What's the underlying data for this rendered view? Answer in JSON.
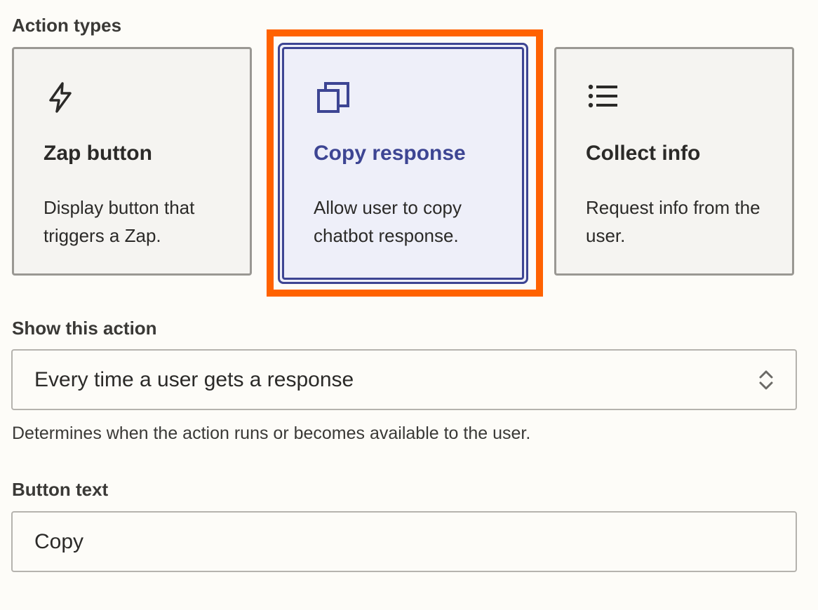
{
  "action_types": {
    "label": "Action types",
    "cards": [
      {
        "title": "Zap button",
        "description": "Display button that triggers a Zap.",
        "icon": "lightning-icon",
        "selected": false
      },
      {
        "title": "Copy response",
        "description": "Allow user to copy chatbot response.",
        "icon": "copy-icon",
        "selected": true
      },
      {
        "title": "Collect info",
        "description": "Request info from the user.",
        "icon": "list-icon",
        "selected": false
      }
    ]
  },
  "show_action": {
    "label": "Show this action",
    "selected": "Every time a user gets a response",
    "helper": "Determines when the action runs or becomes available to the user."
  },
  "button_text": {
    "label": "Button text",
    "value": "Copy"
  },
  "colors": {
    "accent": "#3d4593",
    "highlight": "#ff6200",
    "background": "#fdfcf8"
  }
}
